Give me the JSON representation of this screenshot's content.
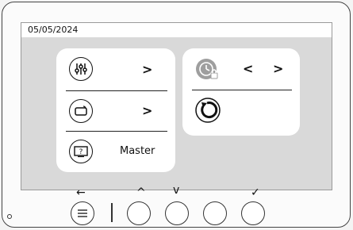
{
  "status": {
    "date": "05/05/2024"
  },
  "menu": {
    "settings_arrow": ">",
    "display_arrow": ">",
    "help_label": "Master"
  },
  "right_panel": {
    "prev_arrow": "<",
    "next_arrow": ">"
  },
  "softkeys": {
    "back": "←",
    "up": "^",
    "down": "v",
    "confirm": "✓"
  },
  "icons": {
    "settings": "sliders-icon",
    "display": "display-icon",
    "help": "help-screen-icon",
    "locked_timer": "lock-clock-icon",
    "refresh": "refresh-icon",
    "menu": "menu-icon"
  }
}
